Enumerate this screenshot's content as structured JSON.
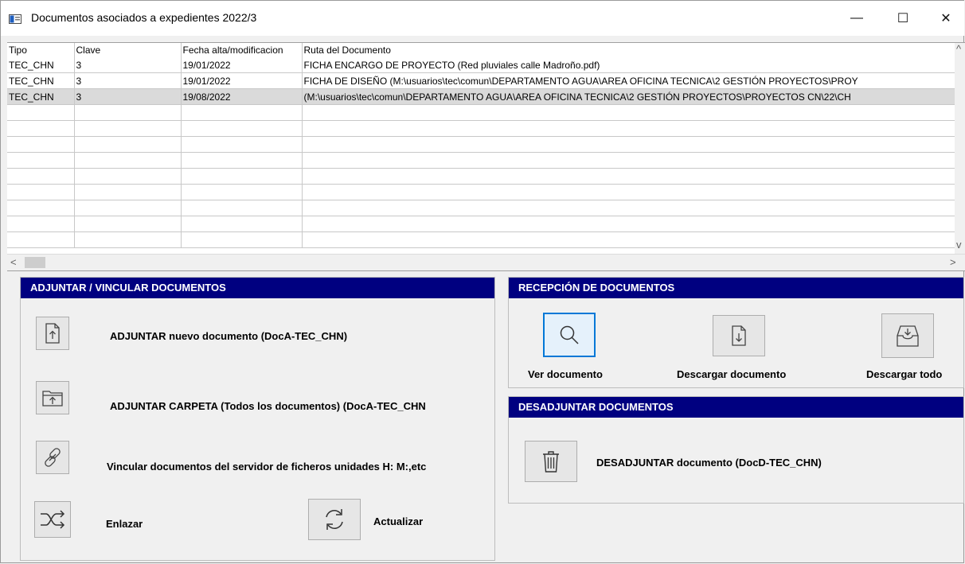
{
  "window": {
    "title": "Documentos asociados a expedientes 2022/3",
    "minimize_glyph": "—",
    "maximize_glyph": "☐",
    "close_glyph": "✕"
  },
  "grid": {
    "columns": [
      "Tipo",
      "Clave",
      "Fecha alta/modificacion",
      "Ruta del Documento"
    ],
    "rows": [
      {
        "tipo": "TEC_CHN",
        "clave": "3",
        "fecha": "19/01/2022",
        "ruta": "FICHA ENCARGO DE PROYECTO (Red pluviales calle Madroño.pdf)"
      },
      {
        "tipo": "TEC_CHN",
        "clave": "3",
        "fecha": "19/01/2022",
        "ruta": "FICHA DE DISEÑO (M:\\usuarios\\tec\\comun\\DEPARTAMENTO AGUA\\AREA OFICINA TECNICA\\2 GESTIÓN PROYECTOS\\PROY"
      },
      {
        "tipo": "TEC_CHN",
        "clave": "3",
        "fecha": "19/08/2022",
        "ruta": " (M:\\usuarios\\tec\\comun\\DEPARTAMENTO AGUA\\AREA OFICINA TECNICA\\2 GESTIÓN PROYECTOS\\PROYECTOS CN\\22\\CH"
      }
    ],
    "selected_row": 3
  },
  "adjuntar": {
    "header": "ADJUNTAR / VINCULAR DOCUMENTOS",
    "nuevo_label": "ADJUNTAR nuevo documento (DocA-TEC_CHN)",
    "carpeta_label": "ADJUNTAR CARPETA (Todos los documentos) (DocA-TEC_CHN",
    "vincular_label": "Vincular documentos del servidor de ficheros unidades H: M:,etc",
    "enlazar_label": "Enlazar",
    "actualizar_label": "Actualizar"
  },
  "recepcion": {
    "header": "RECEPCIÓN DE DOCUMENTOS",
    "ver_label": "Ver documento",
    "descargar_label": "Descargar documento",
    "descargar_todo_label": "Descargar todo"
  },
  "desadjuntar": {
    "header": "DESADJUNTAR DOCUMENTOS",
    "label": "DESADJUNTAR documento (DocD-TEC_CHN)"
  },
  "icons": {
    "app": "window-app-icon",
    "upload_file": "file-upload-icon",
    "upload_folder": "folder-upload-icon",
    "link": "chain-link-icon",
    "shuffle": "shuffle-icon",
    "refresh": "refresh-icon",
    "search": "search-icon",
    "download_file": "file-download-icon",
    "download_all": "tray-download-icon",
    "trash": "trash-icon"
  },
  "colors": {
    "panel_header": "#000080",
    "selected_row": "#dadada",
    "focus_border": "#0078d7"
  }
}
